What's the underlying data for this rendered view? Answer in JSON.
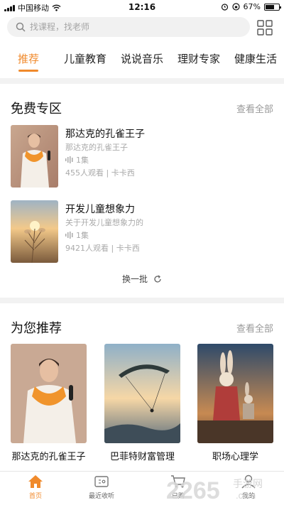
{
  "status_bar": {
    "carrier": "中国移动",
    "time": "12:16",
    "battery": "67%",
    "battery_level": 0.67
  },
  "search": {
    "placeholder": "找课程，找老师"
  },
  "tabs": [
    {
      "label": "推荐",
      "active": true
    },
    {
      "label": "儿童教育"
    },
    {
      "label": "说说音乐"
    },
    {
      "label": "理财专家"
    },
    {
      "label": "健康生活"
    }
  ],
  "free_section": {
    "title": "免费专区",
    "see_all": "查看全部",
    "items": [
      {
        "title": "那达克的孔雀王子",
        "subtitle": "那达克的孔雀王子",
        "episodes": "1集",
        "meta": "455人观看 | 卡卡西"
      },
      {
        "title": "开发儿童想象力",
        "subtitle": "关于开发儿童想象力的",
        "episodes": "1集",
        "meta": "9421人观看 | 卡卡西"
      }
    ],
    "refresh": "换一批"
  },
  "recommend_section": {
    "title": "为您推荐",
    "see_all": "查看全部",
    "items": [
      {
        "title": "那达克的孔雀王子"
      },
      {
        "title": "巴菲特财富管理"
      },
      {
        "title": "职场心理学"
      }
    ]
  },
  "tabbar": {
    "items": [
      {
        "label": "首页",
        "active": true
      },
      {
        "label": "最近收听"
      },
      {
        "label": "已购"
      },
      {
        "label": "我的"
      }
    ]
  },
  "watermark": {
    "brand": "2265",
    "site": "手游网",
    "domain": ".com"
  },
  "colors": {
    "accent": "#f08a2c",
    "muted": "#999999",
    "divider": "#f2f2f2"
  }
}
